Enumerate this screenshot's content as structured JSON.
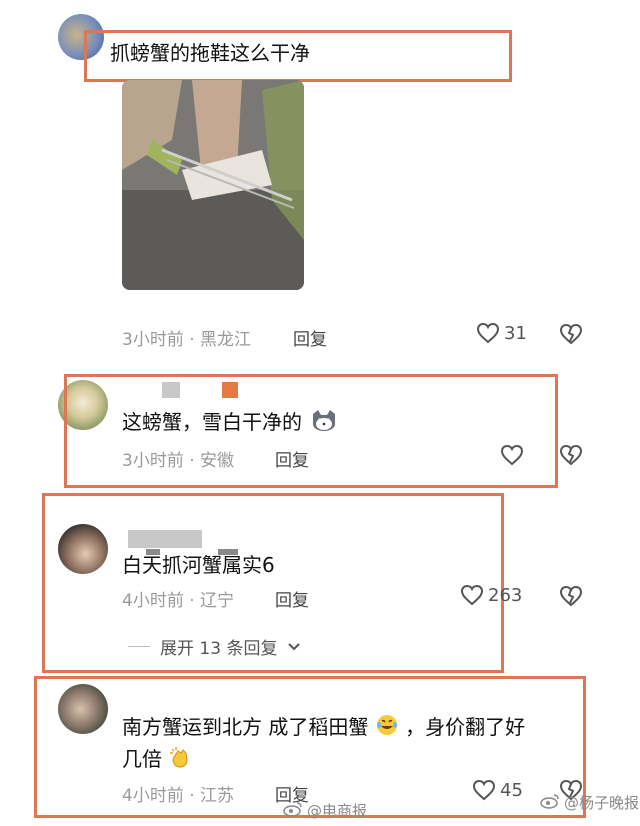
{
  "comments": [
    {
      "text": "抓螃蟹的拖鞋这么干净",
      "time": "3小时前",
      "location": "黑龙江",
      "reply": "回复",
      "likes": "31"
    },
    {
      "text": "这螃蟹，雪白干净的",
      "emoji": "cat-emoji",
      "time": "3小时前",
      "location": "安徽",
      "reply": "回复",
      "likes": ""
    },
    {
      "text": "白天抓河蟹属实6",
      "time": "4小时前",
      "location": "辽宁",
      "reply": "回复",
      "likes": "263",
      "expand": "展开 13 条回复"
    },
    {
      "text_line1": "南方蟹运到北方  成了稻田蟹",
      "text_line1_tail": "，身价翻了好",
      "text_line2": "几倍",
      "emoji1": "laughing-tears-emoji",
      "emoji2": "clapping-hands-emoji",
      "time": "4小时前",
      "location": "江苏",
      "reply": "回复",
      "likes": "45"
    }
  ],
  "meta_sep": "·",
  "watermark": {
    "left": "@电商报",
    "right": "@杨子晚报"
  },
  "colors": {
    "highlight_box": "#dd7654"
  }
}
